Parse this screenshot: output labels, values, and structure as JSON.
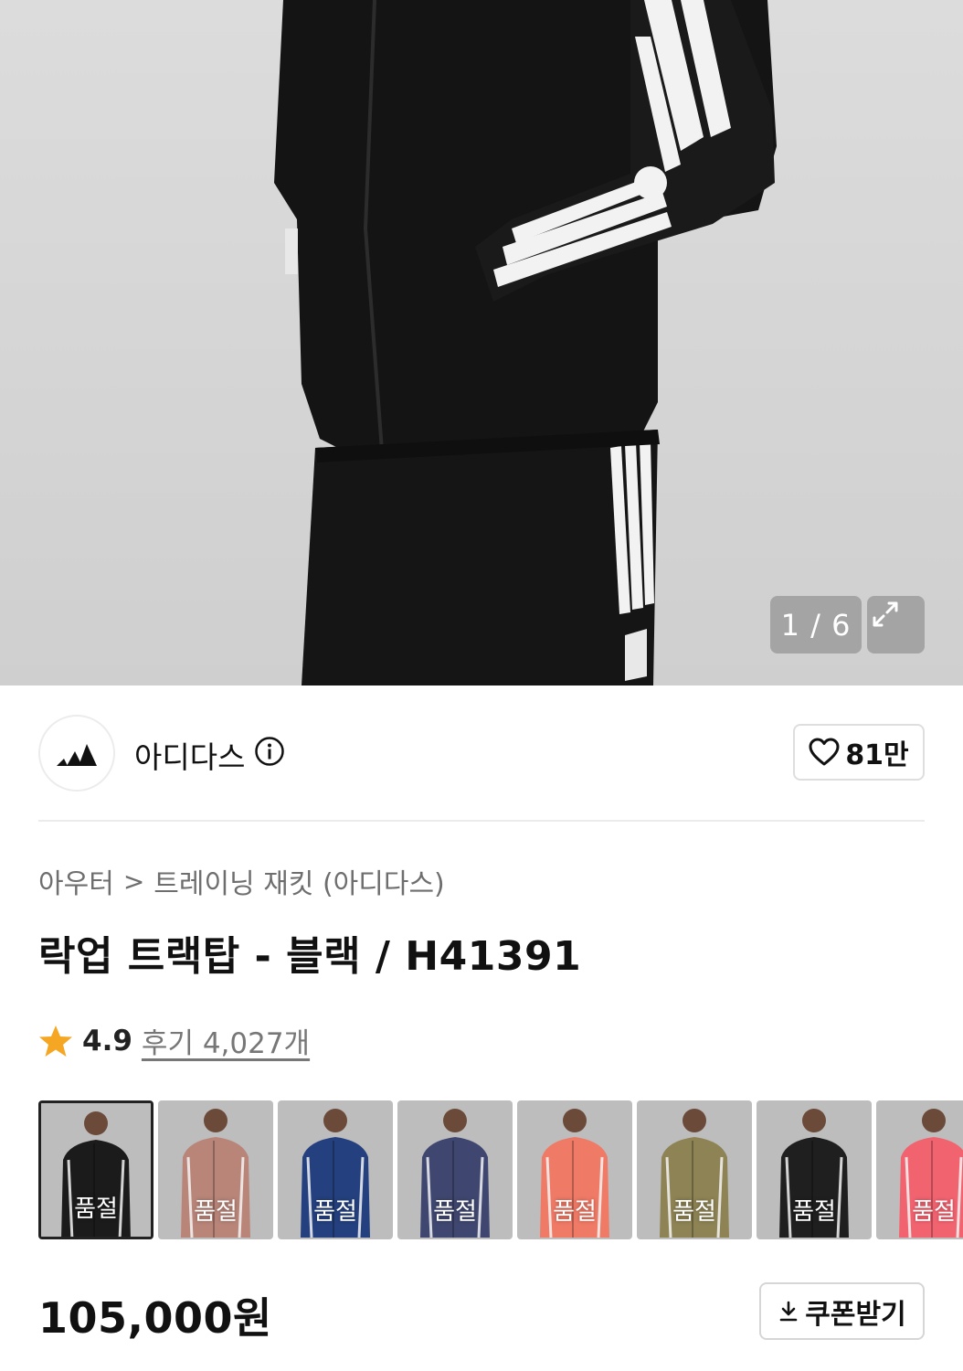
{
  "gallery": {
    "counter": "1 / 6",
    "image_alt": "adidas black track jacket and track pants"
  },
  "brand": {
    "name": "아디다스",
    "likes": "81만"
  },
  "breadcrumb": {
    "level1": "아우터",
    "separator": ">",
    "level2": "트레이닝 재킷 (아디다스)"
  },
  "product": {
    "title": "락업 트랙탑 - 블랙 / H41391",
    "rating": "4.9",
    "reviews": "후기 4,027개",
    "price": "105,000원"
  },
  "colors": [
    {
      "label": "품절",
      "color": "#1b1b1b"
    },
    {
      "label": "품절",
      "color": "#b98579"
    },
    {
      "label": "품절",
      "color": "#24407e"
    },
    {
      "label": "품절",
      "color": "#3f4770"
    },
    {
      "label": "품절",
      "color": "#ef7a66"
    },
    {
      "label": "품절",
      "color": "#8d8354"
    },
    {
      "label": "품절",
      "color": "#1f1f1f"
    },
    {
      "label": "품절",
      "color": "#f26370"
    }
  ],
  "coupon": {
    "label": "쿠폰받기"
  },
  "accent": {
    "star": "#f5a623"
  }
}
